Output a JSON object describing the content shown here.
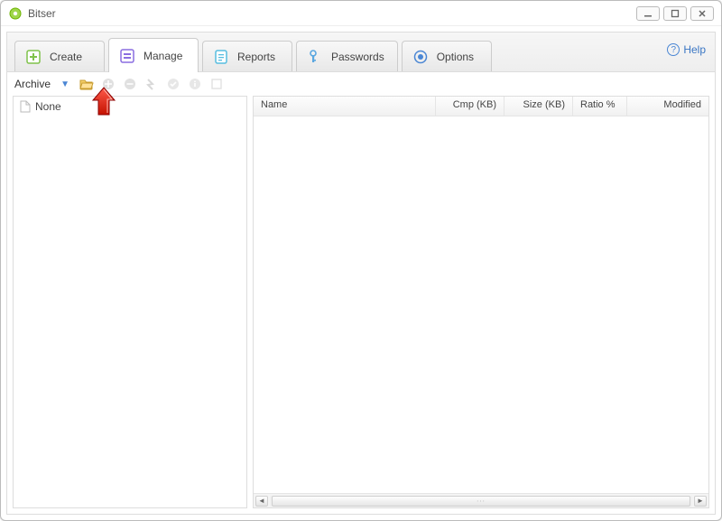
{
  "window": {
    "title": "Bitser",
    "controls": {
      "min": "—",
      "max": "▢",
      "close": "✕"
    }
  },
  "tabs": {
    "items": [
      {
        "label": "Create",
        "icon": "plus-square-icon",
        "active": false
      },
      {
        "label": "Manage",
        "icon": "archive-icon",
        "active": true
      },
      {
        "label": "Reports",
        "icon": "document-icon",
        "active": false
      },
      {
        "label": "Passwords",
        "icon": "key-icon",
        "active": false
      },
      {
        "label": "Options",
        "icon": "target-icon",
        "active": false
      }
    ],
    "help_label": "Help"
  },
  "toolbar": {
    "archive_label": "Archive",
    "buttons": [
      {
        "name": "archive-dropdown-icon",
        "enabled": true
      },
      {
        "name": "open-folder-icon",
        "enabled": true
      },
      {
        "name": "add-icon",
        "enabled": false
      },
      {
        "name": "remove-icon",
        "enabled": false
      },
      {
        "name": "extract-icon",
        "enabled": false
      },
      {
        "name": "test-icon",
        "enabled": false
      },
      {
        "name": "info-icon",
        "enabled": false
      },
      {
        "name": "view-icon",
        "enabled": false
      }
    ]
  },
  "tree": {
    "items": [
      {
        "label": "None",
        "icon": "blank-file-icon"
      }
    ]
  },
  "list": {
    "columns": {
      "name": "Name",
      "cmp": "Cmp (KB)",
      "size": "Size (KB)",
      "ratio": "Ratio %",
      "modified": "Modified"
    },
    "rows": []
  },
  "annotation": {
    "arrow_points_to": "open-folder-icon"
  }
}
